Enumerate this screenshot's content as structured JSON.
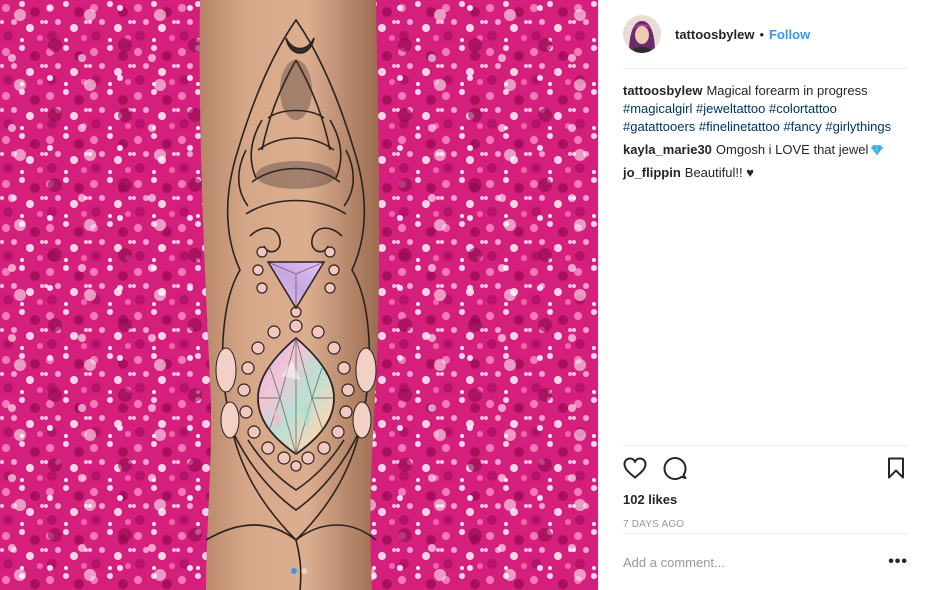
{
  "post": {
    "author": {
      "username": "tattoosbylew",
      "separator": "•",
      "follow_label": "Follow"
    },
    "caption": {
      "username": "tattoosbylew",
      "text": "Magical forearm in progress",
      "hashtags": "#magicalgirl #jeweltattoo #colortattoo #gatattooers #finelinetattoo #fancy #girlythings"
    },
    "comments": [
      {
        "username": "kayla_marie30",
        "text": "Omgosh i LOVE that jewel",
        "emoji": "gem-icon"
      },
      {
        "username": "jo_flippin",
        "text": "Beautiful!! ♥"
      }
    ],
    "likes": "102 likes",
    "timestamp": "7 DAYS AGO",
    "add_comment_placeholder": "Add a comment...",
    "more_label": "•••",
    "carousel": {
      "slides": 2,
      "active_index": 0
    }
  },
  "icons": {
    "like": "heart-icon",
    "comment": "comment-bubble-icon",
    "save": "bookmark-icon",
    "options": "more-options-icon"
  },
  "colors": {
    "link_blue": "#3897f0",
    "hashtag_blue": "#003569",
    "meta_gray": "#999999",
    "text": "#262626",
    "divider": "#efefef",
    "glitter_pink": "#d81b7a"
  }
}
